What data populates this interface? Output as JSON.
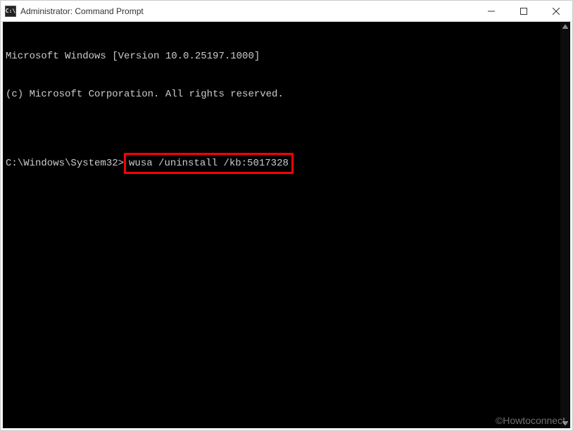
{
  "titlebar": {
    "icon_label": "cmd-icon",
    "title": "Administrator: Command Prompt"
  },
  "terminal": {
    "line1": "Microsoft Windows [Version 10.0.25197.1000]",
    "line2": "(c) Microsoft Corporation. All rights reserved.",
    "blank": "",
    "prompt": "C:\\Windows\\System32>",
    "command": "wusa /uninstall /kb:5017328"
  },
  "watermark": "©Howtoconnect"
}
